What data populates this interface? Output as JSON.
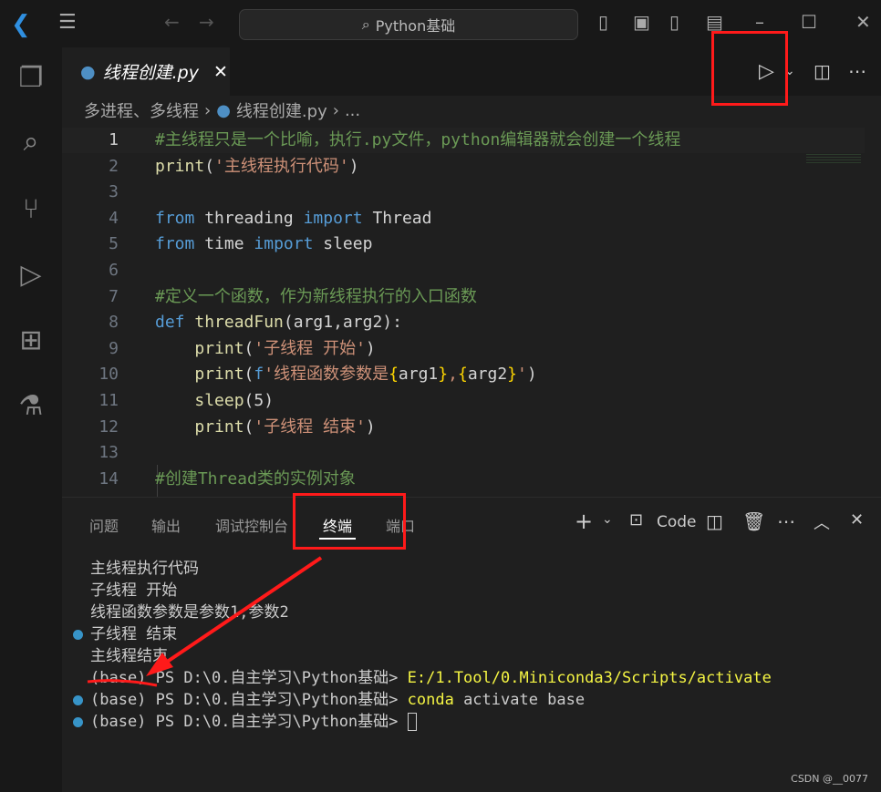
{
  "titlebar": {
    "search": "Python基础",
    "icons": [
      "vscode-logo-icon",
      "menu-icon",
      "back-arrow-icon",
      "forward-arrow-icon",
      "toggle-sidebar-icon",
      "toggle-panel-icon",
      "toggle-secondary-sidebar-icon",
      "customize-layout-icon",
      "minimize-icon",
      "maximize-icon",
      "close-icon"
    ]
  },
  "activity": [
    "explorer-icon",
    "search-icon",
    "source-control-icon",
    "run-debug-icon",
    "extensions-icon",
    "testing-icon"
  ],
  "tab": {
    "label": "线程创建.py"
  },
  "breadcrumb": {
    "folder": "多进程、多线程",
    "file": "线程创建.py",
    "more": "..."
  },
  "colors": {
    "comment": "#6a9955",
    "keyword": "#569cd6",
    "string": "#ce9178",
    "function": "#dcdcaa",
    "text": "#d4d4d4",
    "brace": "#ffd700",
    "accent": "#3794c8",
    "annotation": "#ff1a1a"
  },
  "code": [
    {
      "n": "1",
      "t": [
        [
          "c",
          "#主线程只是一个比喻，执行.py文件，python编辑器就会创建一个线程"
        ]
      ]
    },
    {
      "n": "2",
      "t": [
        [
          "f",
          "print"
        ],
        [
          "x",
          "("
        ],
        [
          "s",
          "'主线程执行代码'"
        ],
        [
          "x",
          ")"
        ]
      ]
    },
    {
      "n": "3",
      "t": []
    },
    {
      "n": "4",
      "t": [
        [
          "k",
          "from"
        ],
        [
          "x",
          " threading "
        ],
        [
          "k",
          "import"
        ],
        [
          "x",
          " Thread"
        ]
      ]
    },
    {
      "n": "5",
      "t": [
        [
          "k",
          "from"
        ],
        [
          "x",
          " time "
        ],
        [
          "k",
          "import"
        ],
        [
          "x",
          " sleep"
        ]
      ]
    },
    {
      "n": "6",
      "t": []
    },
    {
      "n": "7",
      "t": [
        [
          "c",
          "#定义一个函数，作为新线程执行的入口函数"
        ]
      ]
    },
    {
      "n": "8",
      "t": [
        [
          "k",
          "def"
        ],
        [
          "x",
          " "
        ],
        [
          "f",
          "threadFun"
        ],
        [
          "x",
          "(arg1,arg2):"
        ]
      ]
    },
    {
      "n": "9",
      "t": [
        [
          "x",
          "    "
        ],
        [
          "f",
          "print"
        ],
        [
          "x",
          "("
        ],
        [
          "s",
          "'子线程 开始'"
        ],
        [
          "x",
          ")"
        ]
      ]
    },
    {
      "n": "10",
      "t": [
        [
          "x",
          "    "
        ],
        [
          "f",
          "print"
        ],
        [
          "x",
          "("
        ],
        [
          "k",
          "f"
        ],
        [
          "s",
          "'线程函数参数是"
        ],
        [
          "b",
          "{"
        ],
        [
          "x",
          "arg1"
        ],
        [
          "b",
          "}"
        ],
        [
          "s",
          ","
        ],
        [
          "b",
          "{"
        ],
        [
          "x",
          "arg2"
        ],
        [
          "b",
          "}"
        ],
        [
          "s",
          "'"
        ],
        [
          "x",
          ")"
        ]
      ]
    },
    {
      "n": "11",
      "t": [
        [
          "x",
          "    "
        ],
        [
          "f",
          "sleep"
        ],
        [
          "x",
          "(5)"
        ]
      ]
    },
    {
      "n": "12",
      "t": [
        [
          "x",
          "    "
        ],
        [
          "f",
          "print"
        ],
        [
          "x",
          "("
        ],
        [
          "s",
          "'子线程 结束'"
        ],
        [
          "x",
          ")"
        ]
      ]
    },
    {
      "n": "13",
      "t": []
    },
    {
      "n": "14",
      "t": [
        [
          "c",
          "#创建Thread类的实例对象"
        ]
      ]
    }
  ],
  "panel": {
    "tabs": [
      "问题",
      "输出",
      "调试控制台",
      "终端",
      "端口"
    ],
    "active": "终端",
    "terminal_name": "Code"
  },
  "terminal": [
    {
      "dot": false,
      "text": "主线程执行代码"
    },
    {
      "dot": false,
      "text": "子线程 开始"
    },
    {
      "dot": false,
      "text": "线程函数参数是参数1,参数2"
    },
    {
      "dot": true,
      "text": "子线程 结束"
    },
    {
      "dot": false,
      "text": "主线程结束"
    },
    {
      "dot": false,
      "text": "(base) PS D:\\0.自主学习\\Python基础> ",
      "cmd": "E:/1.Tool/0.Miniconda3/Scripts/activate"
    },
    {
      "dot": true,
      "text": "(base) PS D:\\0.自主学习\\Python基础> ",
      "cmd": "conda",
      "rest": " activate base"
    },
    {
      "dot": true,
      "text": "(base) PS D:\\0.自主学习\\Python基础> ",
      "cursor": true
    }
  ],
  "watermark": "CSDN @__0077"
}
